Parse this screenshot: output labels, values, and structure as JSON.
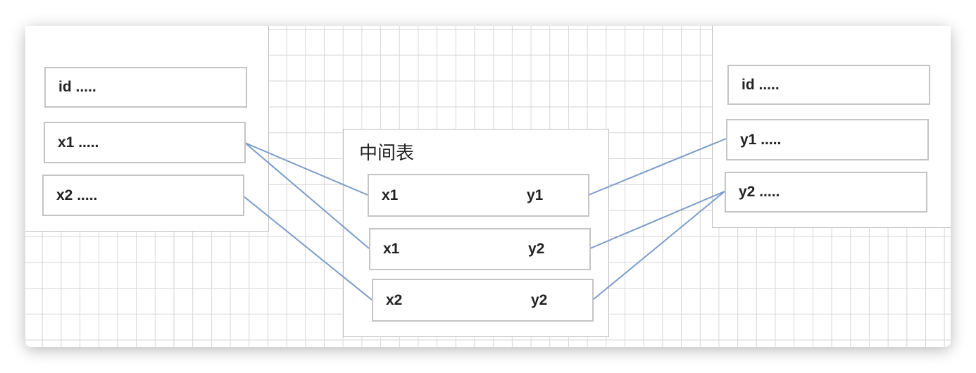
{
  "left_table": {
    "fields": [
      "id .....",
      "x1 .....",
      "x2 ....."
    ]
  },
  "middle_table": {
    "title": "中间表",
    "rows": [
      {
        "left": "x1",
        "right": "y1"
      },
      {
        "left": "x1",
        "right": "y2"
      },
      {
        "left": "x2",
        "right": "y2"
      }
    ]
  },
  "right_table": {
    "fields": [
      "id .....",
      "y1 .....",
      "y2 ....."
    ]
  },
  "connections": [
    {
      "from": "left x1",
      "to": "middle row 1"
    },
    {
      "from": "left x1",
      "to": "middle row 2"
    },
    {
      "from": "left x2",
      "to": "middle row 3"
    },
    {
      "from": "middle row 1",
      "to": "right y1"
    },
    {
      "from": "middle row 2",
      "to": "right y2"
    },
    {
      "from": "middle row 3",
      "to": "right y2"
    }
  ],
  "colors": {
    "connector": "#7b9ccb",
    "grid": "#d6d6d6",
    "border": "#c4c4c4"
  }
}
